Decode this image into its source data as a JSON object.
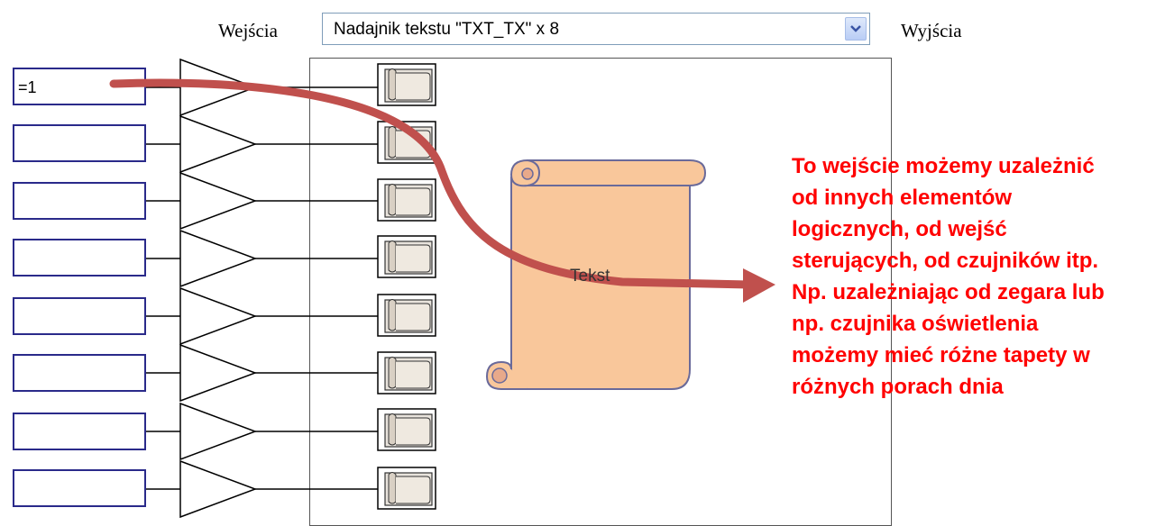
{
  "header": {
    "inputs_label": "Wejścia",
    "outputs_label": "Wyjścia",
    "selector": {
      "value": "Nadajnik tekstu \"TXT_TX\" x 8"
    }
  },
  "inputs": [
    {
      "value": "=1"
    },
    {
      "value": ""
    },
    {
      "value": ""
    },
    {
      "value": ""
    },
    {
      "value": ""
    },
    {
      "value": ""
    },
    {
      "value": ""
    },
    {
      "value": ""
    }
  ],
  "preview": {
    "label": "Tekst"
  },
  "annotation": {
    "lines": [
      "To wejście możemy uzależnić",
      "od innych elementów",
      "logicznych, od wejść",
      "sterujących, od czujników itp.",
      "Np. uzależniając od zegara lub",
      "np. czujnika oświetlenia",
      "możemy mieć różne tapety w",
      "różnych porach dnia"
    ]
  },
  "colors": {
    "scroll_fill": "#f9c79b",
    "scroll_stroke": "#6a6a9a",
    "arrow": "#c0504d",
    "annotation_text": "#ff0000",
    "input_border": "#2a2a8a"
  },
  "icons": {
    "dropdown": "chevron-down-icon",
    "buffer": "buffer-gate-icon",
    "output_block": "text-scroll-icon",
    "preview": "scroll-icon",
    "annotation_arrow": "curved-arrow-icon"
  }
}
